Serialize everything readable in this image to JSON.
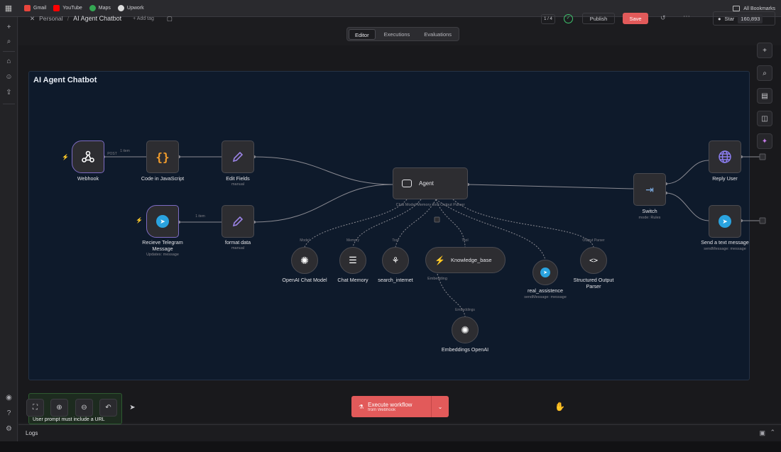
{
  "bookmarks": {
    "items": [
      {
        "label": "Gmail",
        "color": "#e8453c"
      },
      {
        "label": "YouTube",
        "color": "#ff0000"
      },
      {
        "label": "Maps",
        "color": "#34a853"
      },
      {
        "label": "Upwork",
        "color": "#dddddd"
      }
    ],
    "all_label": "All Bookmarks"
  },
  "header": {
    "personal": "Personal",
    "workflow_title": "AI Agent Chatbot",
    "add_tag": "+ Add tag",
    "version": "1 / 4",
    "publish": "Publish",
    "save": "Save",
    "star": "Star",
    "star_count": "160,893"
  },
  "tabs": [
    {
      "label": "Editor",
      "active": true
    },
    {
      "label": "Executions",
      "active": false
    },
    {
      "label": "Evaluations",
      "active": false
    }
  ],
  "sticky_title": "AI Agent Chatbot",
  "nodes": {
    "webhook": {
      "label": "Webhook"
    },
    "code": {
      "label": "Code in JavaScript"
    },
    "edit_fields": {
      "label": "Edit Fields",
      "sub": "manual"
    },
    "telegram_trigger": {
      "label": "Recieve Telegram Message",
      "sub": "Updates: message"
    },
    "format_data": {
      "label": "format data",
      "sub": "manual"
    },
    "agent": {
      "label": "Agent",
      "ports": "Chat Model   Memory   Tool   Output Parser"
    },
    "openai_chat": {
      "label": "OpenAI Chat Model"
    },
    "chat_memory": {
      "label": "Chat Memory"
    },
    "search_internet": {
      "label": "search_internet"
    },
    "knowledge_base": {
      "label": "Knowledge_base",
      "port": "Embedding"
    },
    "real_assistence": {
      "label": "real_assistence",
      "sub": "sendMessage: message"
    },
    "structured_parser": {
      "label": "Structured Output Parser"
    },
    "embeddings": {
      "label": "Embeddings OpenAI"
    },
    "switch": {
      "label": "Switch",
      "sub": "mode: Rules"
    },
    "reply_user": {
      "label": "Reply User"
    },
    "send_text": {
      "label": "Send a text message",
      "sub": "sendMessage: message"
    }
  },
  "edge_labels": {
    "webhook_out": "POST",
    "item1": "1 item",
    "item2": "1 item",
    "model": "Model",
    "memory": "Memory",
    "tool1": "Tool",
    "tool2": "Tool",
    "output_parser": "Output Parser",
    "embeddings": "Embeddings"
  },
  "execute": {
    "label": "Execute workflow",
    "sub": "from Webhook"
  },
  "prompt_warning": "User prompt must include a URL",
  "logs_label": "Logs",
  "colors": {
    "accent": "#e25a5a",
    "telegram": "#2aa3df",
    "code": "#f59e2c",
    "edit": "#9b83e6",
    "globe": "#6b5bd6",
    "knowledge": "#3ec46d"
  }
}
